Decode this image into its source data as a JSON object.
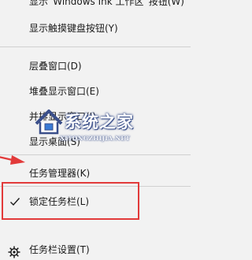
{
  "menu": {
    "items": [
      {
        "label": "显示“Windows Ink 工作区”按钮(W)"
      },
      {
        "label": "显示触摸键盘按钮(Y)"
      },
      {
        "label": "层叠窗口(D)"
      },
      {
        "label": "堆叠显示窗口(E)"
      },
      {
        "label": "并排显示窗口(I)"
      },
      {
        "label": "显示桌面(S)"
      },
      {
        "label": "任务管理器(K)"
      },
      {
        "label": "锁定任务栏(L)",
        "checked": true
      },
      {
        "label": "任务栏设置(T)"
      }
    ]
  },
  "icons": {
    "check": "checkmark-icon",
    "settings": "gear-icon"
  },
  "annotation": {
    "highlight_color": "#e23a3a",
    "arrow_color": "#e23a3a"
  },
  "watermark": {
    "title": "系统之家",
    "url": "XITONGZHIJIA.NET"
  }
}
